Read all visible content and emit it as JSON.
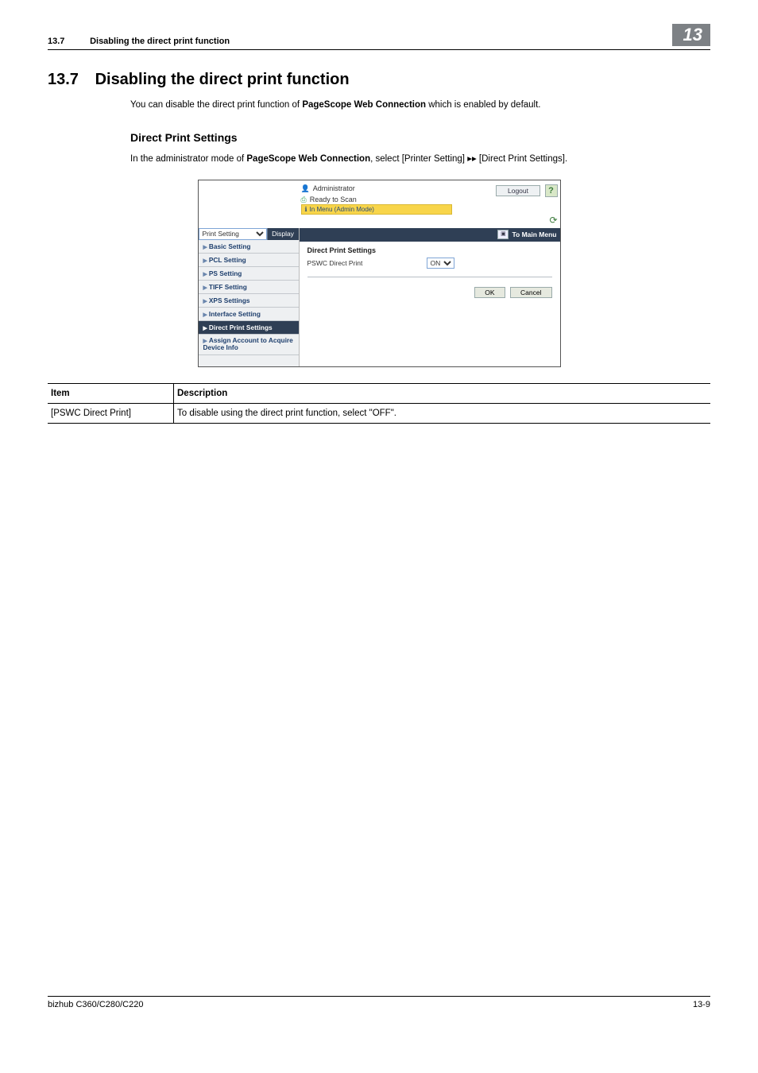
{
  "header": {
    "chapter_small": "13.7",
    "chapter_title": "Disabling the direct print function",
    "chapter_badge": "13"
  },
  "section": {
    "number": "13.7",
    "title": "Disabling the direct print function",
    "intro_pre": "You can disable the direct print function of ",
    "intro_bold": "PageScope Web Connection",
    "intro_post": " which is enabled by default."
  },
  "sub": {
    "title": "Direct Print Settings",
    "line_pre": "In the administrator mode of ",
    "line_bold": "PageScope Web Connection",
    "line_mid": ", select [Printer Setting] ",
    "line_arrow": "▸▸",
    "line_post": " [Direct Print Settings]."
  },
  "app": {
    "user_label": "Administrator",
    "status_label": "Ready to Scan",
    "menu_banner": "In Menu (Admin Mode)",
    "logout": "Logout",
    "help": "?",
    "side_select": "Print Setting",
    "display_btn": "Display",
    "to_main_menu": "To Main Menu",
    "side_items": [
      "Basic Setting",
      "PCL Setting",
      "PS Setting",
      "TIFF Setting",
      "XPS Settings",
      "Interface Setting",
      "Direct Print Settings",
      "Assign Account to Acquire Device Info"
    ],
    "panel_title": "Direct Print Settings",
    "panel_field": "PSWC Direct Print",
    "panel_value": "ON",
    "ok": "OK",
    "cancel": "Cancel"
  },
  "table": {
    "h1": "Item",
    "h2": "Description",
    "r1c1": "[PSWC Direct Print]",
    "r1c2": "To disable using the direct print function, select \"OFF\"."
  },
  "footer": {
    "left": "bizhub C360/C280/C220",
    "right": "13-9"
  }
}
